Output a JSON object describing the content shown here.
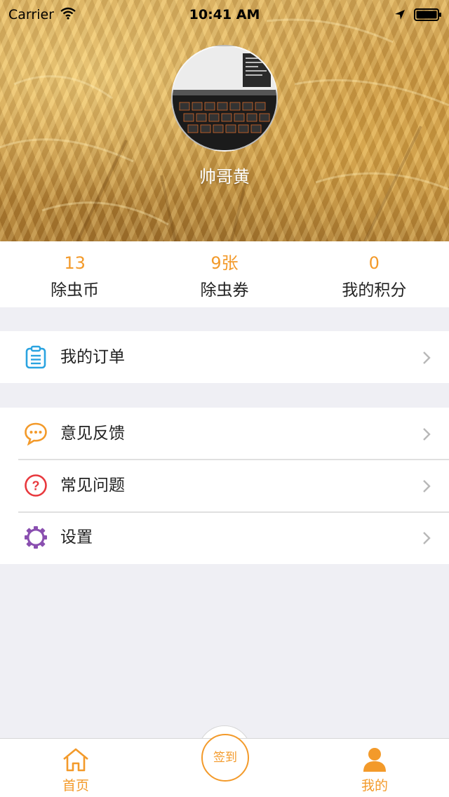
{
  "status_bar": {
    "carrier": "Carrier",
    "time": "10:41 AM"
  },
  "profile": {
    "username": "帅哥黄"
  },
  "stats": [
    {
      "value": "13",
      "label": "除虫币"
    },
    {
      "value": "9张",
      "label": "除虫券"
    },
    {
      "value": "0",
      "label": "我的积分"
    }
  ],
  "menu": {
    "orders": {
      "label": "我的订单",
      "icon": "clipboard-icon"
    },
    "feedback": {
      "label": "意见反馈",
      "icon": "chat-bubble-icon"
    },
    "faq": {
      "label": "常见问题",
      "icon": "question-icon"
    },
    "settings": {
      "label": "设置",
      "icon": "gear-icon"
    }
  },
  "tabbar": {
    "home": {
      "label": "首页",
      "icon": "home-icon"
    },
    "checkin": {
      "label": "签到"
    },
    "mine": {
      "label": "我的",
      "icon": "user-icon"
    }
  },
  "colors": {
    "accent": "#f39a2a",
    "background": "#efeff4"
  }
}
